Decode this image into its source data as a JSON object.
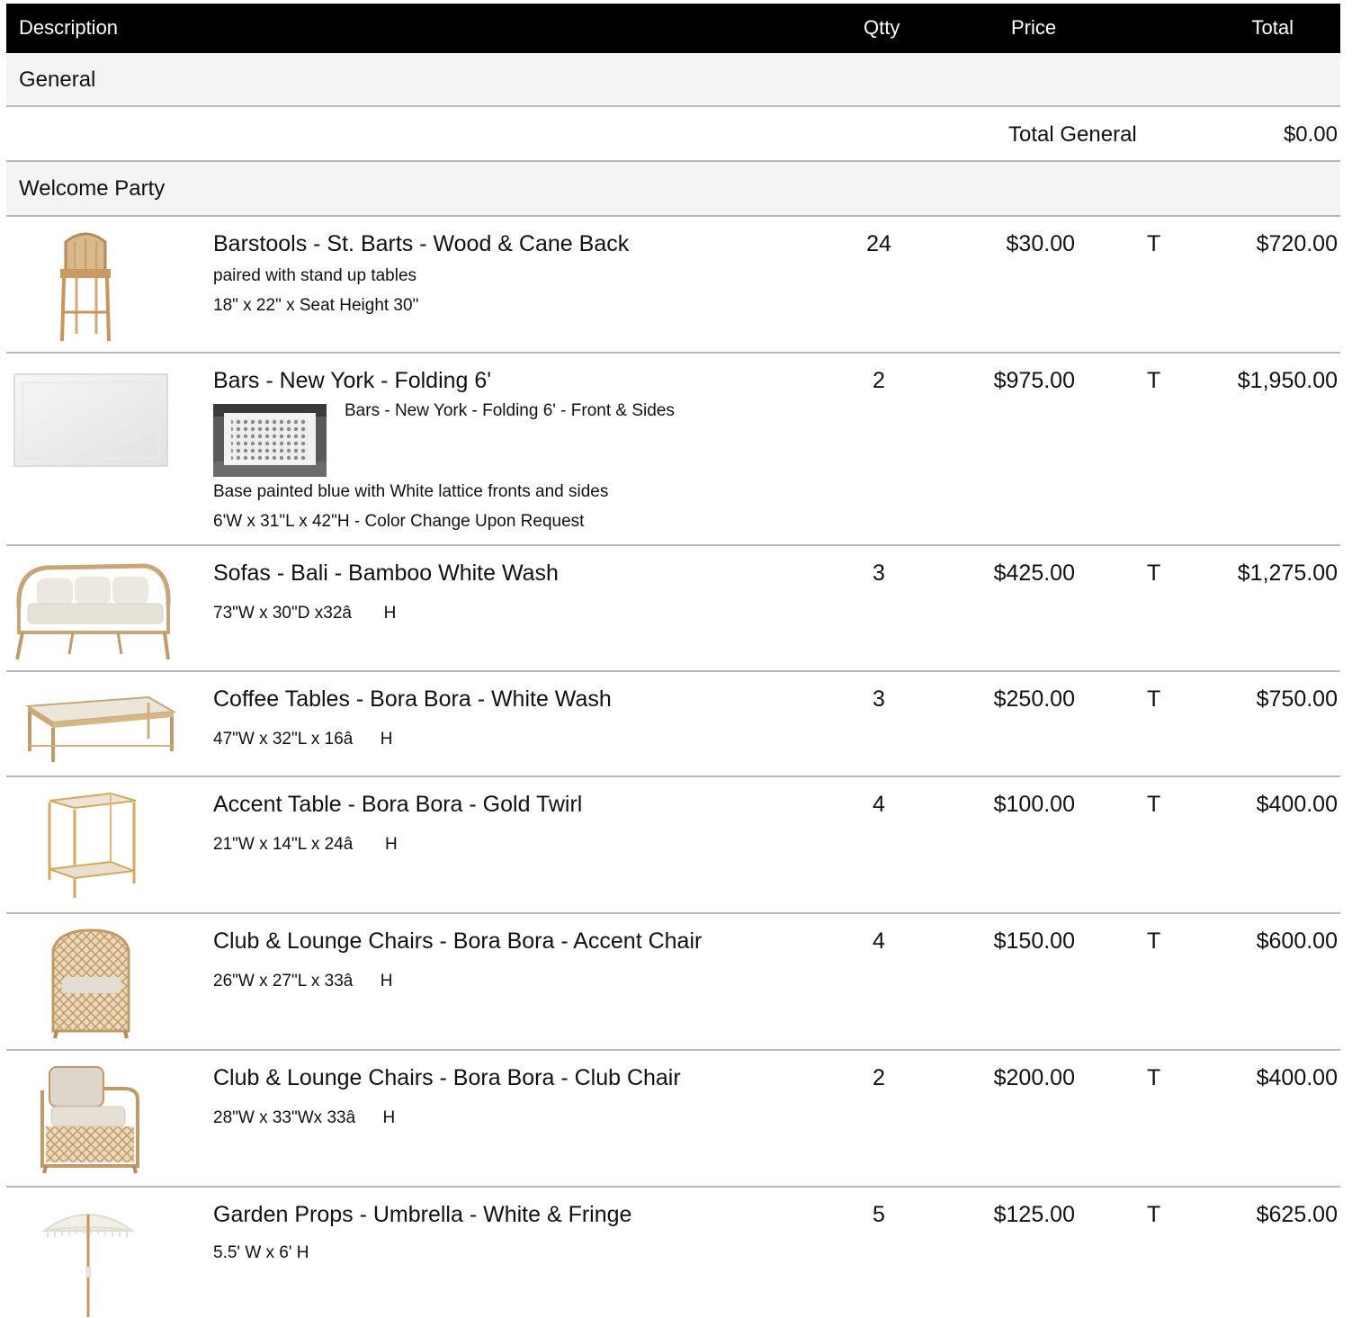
{
  "table": {
    "columns": {
      "description": "Description",
      "qty": "Qtty",
      "price": "Price",
      "total": "Total"
    }
  },
  "sections": [
    {
      "title": "General",
      "subtotal_label": "Total General",
      "subtotal_value": "$0.00"
    },
    {
      "title": "Welcome Party"
    }
  ],
  "items": [
    {
      "name": "Barstools - St. Barts - Wood & Cane Back",
      "notes": [
        "paired with stand up tables",
        "18\" x 22\" x Seat Height 30\""
      ],
      "qty": "24",
      "price": "$30.00",
      "tax": "T",
      "total": "$720.00",
      "icon": "barstool-image"
    },
    {
      "name": "Bars - New York - Folding 6'",
      "inset_caption": "Bars - New York - Folding 6' - Front & Sides",
      "notes": [
        "Base painted blue with White lattice fronts and sides",
        "6'W x 31\"L x  42\"H - Color Change Upon Request"
      ],
      "qty": "2",
      "price": "$975.00",
      "tax": "T",
      "total": "$1,950.00",
      "icon": "bar-image"
    },
    {
      "name": "Sofas - Bali - Bamboo White Wash",
      "notes": [
        "73\"W x 30\"D x32â H"
      ],
      "qty": "3",
      "price": "$425.00",
      "tax": "T",
      "total": "$1,275.00",
      "icon": "sofa-image"
    },
    {
      "name": "Coffee Tables - Bora Bora - White Wash",
      "notes": [
        "47\"W x 32\"L x 16âH"
      ],
      "qty": "3",
      "price": "$250.00",
      "tax": "T",
      "total": "$750.00",
      "icon": "coffee-table-image"
    },
    {
      "name": "Accent Table - Bora Bora - Gold Twirl",
      "notes": [
        "21\"W x 14\"L x 24â H"
      ],
      "qty": "4",
      "price": "$100.00",
      "tax": "T",
      "total": "$400.00",
      "icon": "accent-table-image"
    },
    {
      "name": "Club & Lounge Chairs - Bora Bora - Accent Chair",
      "notes": [
        "26\"W x 27\"L x 33âH"
      ],
      "qty": "4",
      "price": "$150.00",
      "tax": "T",
      "total": "$600.00",
      "icon": "accent-chair-image"
    },
    {
      "name": "Club & Lounge Chairs - Bora Bora - Club Chair",
      "notes": [
        "28\"W x 33\"Wx 33âH"
      ],
      "qty": "2",
      "price": "$200.00",
      "tax": "T",
      "total": "$400.00",
      "icon": "club-chair-image"
    },
    {
      "name": "Garden Props - Umbrella - White & Fringe",
      "notes": [
        "5.5' W x 6' H"
      ],
      "qty": "5",
      "price": "$125.00",
      "tax": "T",
      "total": "$625.00",
      "icon": "umbrella-image"
    }
  ]
}
